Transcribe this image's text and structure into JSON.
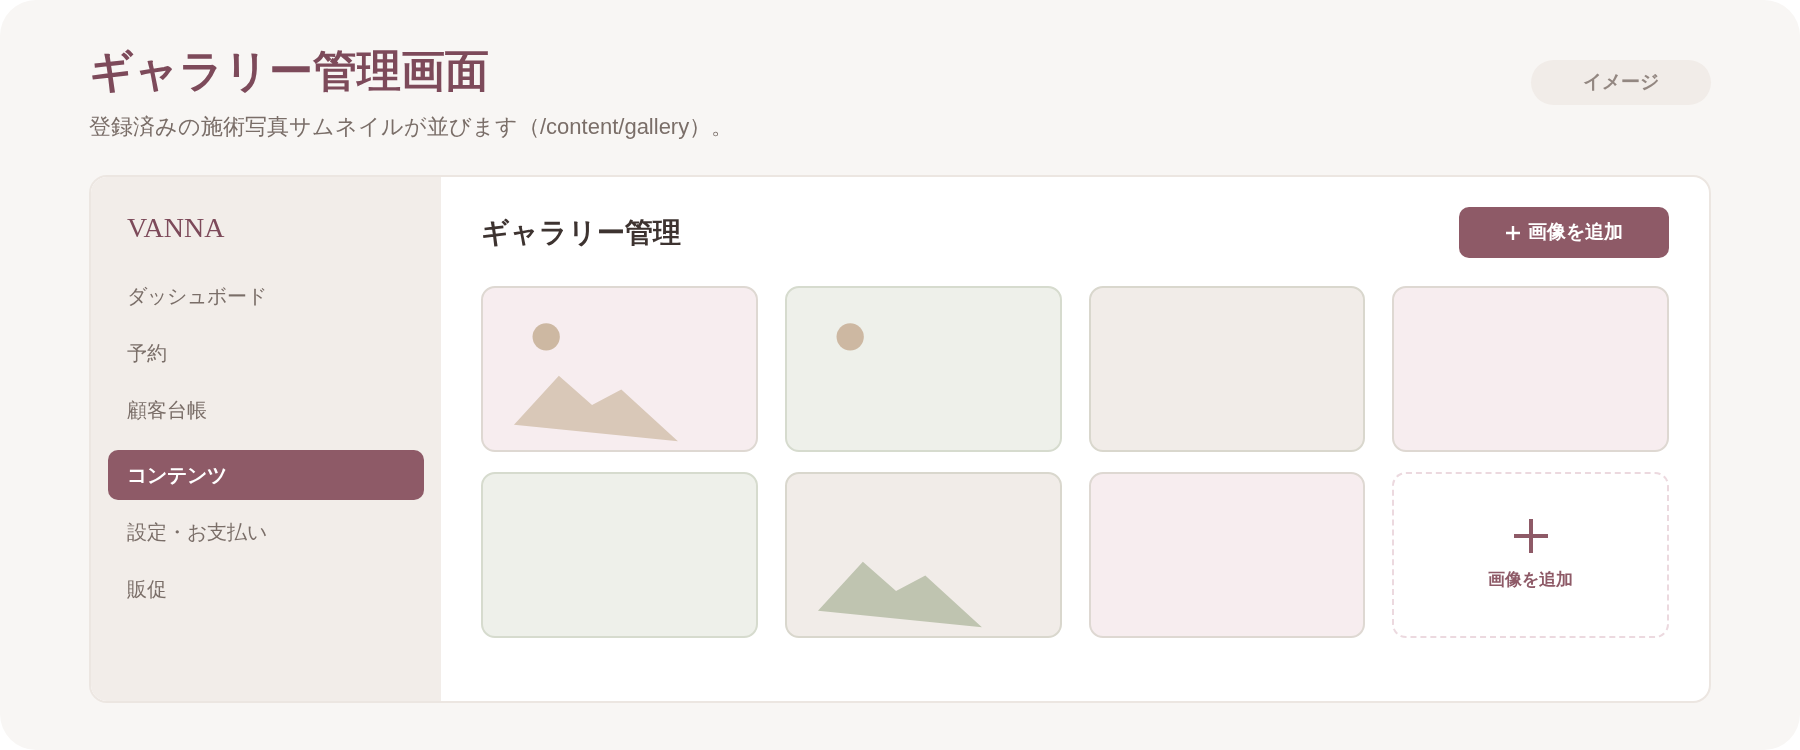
{
  "header": {
    "title": "ギャラリー管理画面",
    "subtitle": "登録済みの施術写真サムネイルが並びます（/content/gallery）。",
    "badge": "イメージ"
  },
  "sidebar": {
    "brand": "VANNA",
    "items": [
      {
        "label": "ダッシュボード",
        "selected": false
      },
      {
        "label": "予約",
        "selected": false
      },
      {
        "label": "顧客台帳",
        "selected": false
      },
      {
        "label": "コンテンツ",
        "selected": true
      },
      {
        "label": "設定・お支払い",
        "selected": false
      },
      {
        "label": "販促",
        "selected": false
      }
    ]
  },
  "content": {
    "title": "ギャラリー管理",
    "add_button": "画像を追加",
    "tiles": [
      {
        "kind": "picture",
        "color": "#f7edef",
        "sun": true,
        "mountains": true
      },
      {
        "kind": "picture",
        "color": "#eef0ea",
        "sun": true,
        "mountains": false
      },
      {
        "kind": "picture",
        "color": "#f1ece8",
        "sun": false,
        "mountains": false
      },
      {
        "kind": "picture",
        "color": "#f7edef",
        "sun": false,
        "mountains": false
      },
      {
        "kind": "picture",
        "color": "#eef0ea",
        "sun": false,
        "mountains": false
      },
      {
        "kind": "picture",
        "color": "#f1ece8",
        "sun": false,
        "mountains": true
      },
      {
        "kind": "picture",
        "color": "#f7edef",
        "sun": false,
        "mountains": false
      },
      {
        "kind": "add",
        "label": "画像を追加"
      }
    ]
  }
}
